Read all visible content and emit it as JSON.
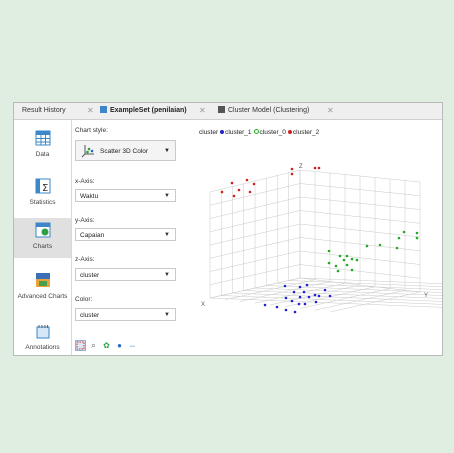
{
  "tabs": [
    {
      "label": "Result History"
    },
    {
      "label": "ExampleSet (penilaian)"
    },
    {
      "label": "Cluster Model (Clustering)"
    }
  ],
  "sidebar": {
    "items": [
      {
        "label": "Data",
        "icon": "table-icon"
      },
      {
        "label": "Statistics",
        "icon": "sigma-icon"
      },
      {
        "label": "Charts",
        "icon": "chart-icon"
      },
      {
        "label": "Advanced Charts",
        "icon": "advanced-chart-icon"
      },
      {
        "label": "Annotations",
        "icon": "annotation-icon"
      }
    ]
  },
  "panel": {
    "chart_style_label": "Chart style:",
    "chart_style_value": "Scatter 3D Color",
    "x_axis_label": "x-Axis:",
    "x_axis_value": "Waktu",
    "y_axis_label": "y-Axis:",
    "y_axis_value": "Capaian",
    "z_axis_label": "z-Axis:",
    "z_axis_value": "cluster",
    "color_label": "Color:",
    "color_value": "cluster"
  },
  "chart": {
    "legend_title": "cluster",
    "axis_z": "Z",
    "axis_x": "X",
    "axis_y": "Y"
  },
  "chart_data": {
    "type": "scatter",
    "series": [
      {
        "name": "cluster_1",
        "color": "#2222cc"
      },
      {
        "name": "cluster_0",
        "color": "#22aa22"
      },
      {
        "name": "cluster_2",
        "color": "#cc2222"
      }
    ]
  }
}
